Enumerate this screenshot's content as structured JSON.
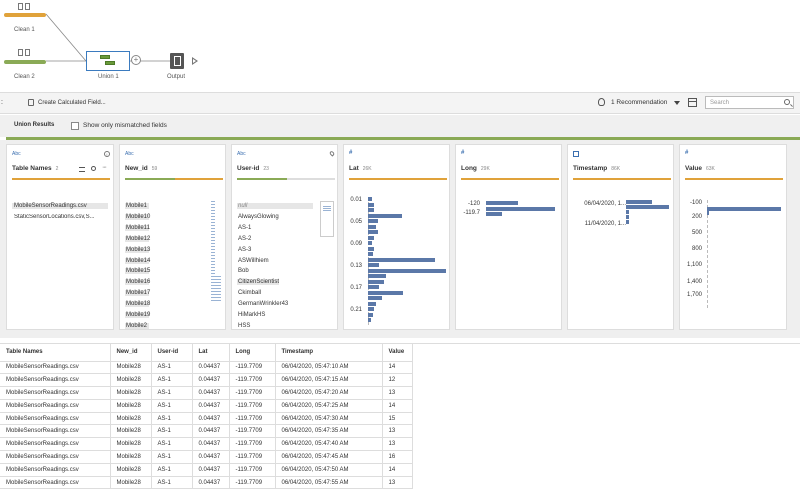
{
  "flow": {
    "steps": [
      {
        "label": "Clean 1",
        "color": "#e0a23a"
      },
      {
        "label": "Clean 2",
        "color": "#8aaa56"
      },
      {
        "label": "Union 1"
      },
      {
        "label": "Output"
      }
    ]
  },
  "toolbar": {
    "create_calc": "Create Calculated Field...",
    "recommendations": "1 Recommendation",
    "search_placeholder": "Search"
  },
  "results": {
    "title": "Union Results",
    "mismatch_label": "Show only mismatched fields"
  },
  "profile": {
    "cards": [
      {
        "type": "Abc",
        "name": "Table Names",
        "count": "2",
        "values": [
          "MobileSensorReadings.csv",
          "StaticSensorLocations.csv,S..."
        ]
      },
      {
        "type": "Abc",
        "name": "New_id",
        "count": "59",
        "values": [
          "Mobile1",
          "Mobile10",
          "Mobile11",
          "Mobile12",
          "Mobile13",
          "Mobile14",
          "Mobile15",
          "Mobile16",
          "Mobile17",
          "Mobile18",
          "Mobile19",
          "Mobile2"
        ]
      },
      {
        "type": "Abc",
        "name": "User-id",
        "count": "23",
        "values": [
          "null",
          "AlwaysGlowing",
          "AS-1",
          "AS-2",
          "AS-3",
          "ASWillhiem",
          "Bob",
          "CitizenScientist",
          "Ckimball",
          "GermanWrinkler43",
          "HiMarkHS",
          "HSS"
        ]
      },
      {
        "type": "#",
        "name": "Lat",
        "count": "26K",
        "axis": [
          "0.01",
          "0.05",
          "0.09",
          "0.13",
          "0.17",
          "0.21"
        ],
        "bars": [
          0.05,
          0.07,
          0.08,
          0.42,
          0.12,
          0.1,
          0.12,
          0.07,
          0.05,
          0.08,
          0.06,
          0.84,
          0.14,
          0.98,
          0.22,
          0.2,
          0.14,
          0.44,
          0.18,
          0.1,
          0.08,
          0.06,
          0.04
        ]
      },
      {
        "type": "#",
        "name": "Long",
        "count": "29K",
        "axis": [
          "-120",
          "-119.7"
        ],
        "bars": [
          0.44,
          0.96,
          0.22
        ]
      },
      {
        "type": "cal",
        "name": "Timestamp",
        "count": "86K",
        "axis": [
          "06/04/2020, 1...",
          "11/04/2020, 1..."
        ],
        "bars": [
          0.58,
          0.95,
          0.06,
          0.06,
          0.07
        ]
      },
      {
        "type": "#",
        "name": "Value",
        "count": "63K",
        "axis": [
          "-100",
          "200",
          "500",
          "800",
          "1,100",
          "1,400",
          "1,700"
        ],
        "bars": [
          0.98,
          0.02
        ]
      }
    ]
  },
  "table": {
    "headers": [
      "Table Names",
      "New_id",
      "User-id",
      "Lat",
      "Long",
      "Timestamp",
      "Value"
    ],
    "rows": [
      [
        "MobileSensorReadings.csv",
        "Mobile28",
        "AS-1",
        "0.04437",
        "-119.7709",
        "06/04/2020, 05:47:10 AM",
        "14"
      ],
      [
        "MobileSensorReadings.csv",
        "Mobile28",
        "AS-1",
        "0.04437",
        "-119.7709",
        "06/04/2020, 05:47:15 AM",
        "12"
      ],
      [
        "MobileSensorReadings.csv",
        "Mobile28",
        "AS-1",
        "0.04437",
        "-119.7709",
        "06/04/2020, 05:47:20 AM",
        "13"
      ],
      [
        "MobileSensorReadings.csv",
        "Mobile28",
        "AS-1",
        "0.04437",
        "-119.7709",
        "06/04/2020, 05:47:25 AM",
        "14"
      ],
      [
        "MobileSensorReadings.csv",
        "Mobile28",
        "AS-1",
        "0.04437",
        "-119.7709",
        "06/04/2020, 05:47:30 AM",
        "15"
      ],
      [
        "MobileSensorReadings.csv",
        "Mobile28",
        "AS-1",
        "0.04437",
        "-119.7709",
        "06/04/2020, 05:47:35 AM",
        "13"
      ],
      [
        "MobileSensorReadings.csv",
        "Mobile28",
        "AS-1",
        "0.04437",
        "-119.7709",
        "06/04/2020, 05:47:40 AM",
        "13"
      ],
      [
        "MobileSensorReadings.csv",
        "Mobile28",
        "AS-1",
        "0.04437",
        "-119.7709",
        "06/04/2020, 05:47:45 AM",
        "16"
      ],
      [
        "MobileSensorReadings.csv",
        "Mobile28",
        "AS-1",
        "0.04437",
        "-119.7709",
        "06/04/2020, 05:47:50 AM",
        "14"
      ],
      [
        "MobileSensorReadings.csv",
        "Mobile28",
        "AS-1",
        "0.04437",
        "-119.7709",
        "06/04/2020, 05:47:55 AM",
        "13"
      ]
    ]
  }
}
